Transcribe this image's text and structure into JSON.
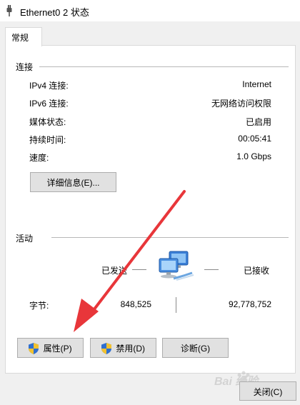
{
  "window": {
    "title": "Ethernet0 2 状态"
  },
  "tabs": [
    {
      "label": "常规",
      "active": true
    }
  ],
  "connection": {
    "section_title": "连接",
    "rows": [
      {
        "label": "IPv4 连接:",
        "value": "Internet"
      },
      {
        "label": "IPv6 连接:",
        "value": "无网络访问权限"
      },
      {
        "label": "媒体状态:",
        "value": "已启用"
      },
      {
        "label": "持续时间:",
        "value": "00:05:41"
      },
      {
        "label": "速度:",
        "value": "1.0 Gbps"
      }
    ],
    "details_button": "详细信息(E)..."
  },
  "activity": {
    "section_title": "活动",
    "sent_label": "已发送",
    "received_label": "已接收",
    "bytes_label": "字节:",
    "bytes_sent": "848,525",
    "bytes_received": "92,778,752"
  },
  "buttons": {
    "properties": "属性(P)",
    "disable": "禁用(D)",
    "diagnose": "诊断(G)",
    "close": "关闭(C)"
  },
  "watermark": {
    "text": "Bai 经验"
  },
  "colors": {
    "dialog_bg": "#f0f0f0",
    "panel_bg": "#ffffff",
    "button_bg": "#e1e1e1",
    "arrow": "#e8363a",
    "shield_blue": "#2f6fd0",
    "shield_yellow": "#f2c230"
  },
  "icons": {
    "title": "network-plug-icon",
    "activity": "network-computers-icon",
    "properties": "uac-shield-icon",
    "disable": "uac-shield-icon"
  }
}
